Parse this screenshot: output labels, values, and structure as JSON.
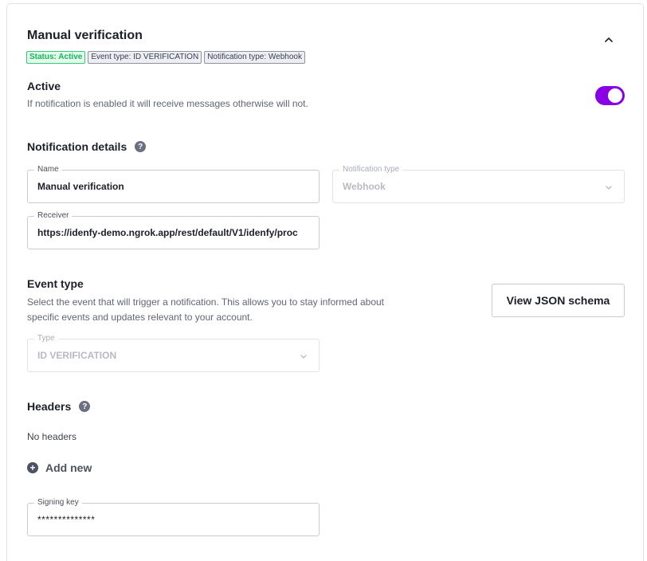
{
  "header": {
    "title": "Manual verification",
    "badges": {
      "status": "Status: Active",
      "event_type": "Event type: ID VERIFICATION",
      "notification_type": "Notification type: Webhook"
    }
  },
  "active": {
    "title": "Active",
    "description": "If notification is enabled it will receive messages otherwise will not.",
    "enabled": true
  },
  "notification_details": {
    "title": "Notification details",
    "name": {
      "label": "Name",
      "value": "Manual verification"
    },
    "notification_type": {
      "label": "Notification type",
      "value": "Webhook"
    },
    "receiver": {
      "label": "Receiver",
      "value": "https://idenfy-demo.ngrok.app/rest/default/V1/idenfy/proc"
    }
  },
  "event_type": {
    "title": "Event type",
    "description_line1": "Select the event that will trigger a notification. This allows you to stay informed about",
    "description_line2": "specific events and updates relevant to your account.",
    "view_schema_label": "View JSON schema",
    "type": {
      "label": "Type",
      "value": "ID VERIFICATION"
    }
  },
  "headers": {
    "title": "Headers",
    "empty_text": "No headers",
    "add_new_label": "Add new"
  },
  "signing_key": {
    "label": "Signing key",
    "value": "**************"
  },
  "colors": {
    "accent": "#8a00e6",
    "status_green": "#14b85a"
  },
  "icons": [
    "chevron-up-icon",
    "help-icon",
    "chevron-down-icon",
    "plus-circle-icon"
  ]
}
